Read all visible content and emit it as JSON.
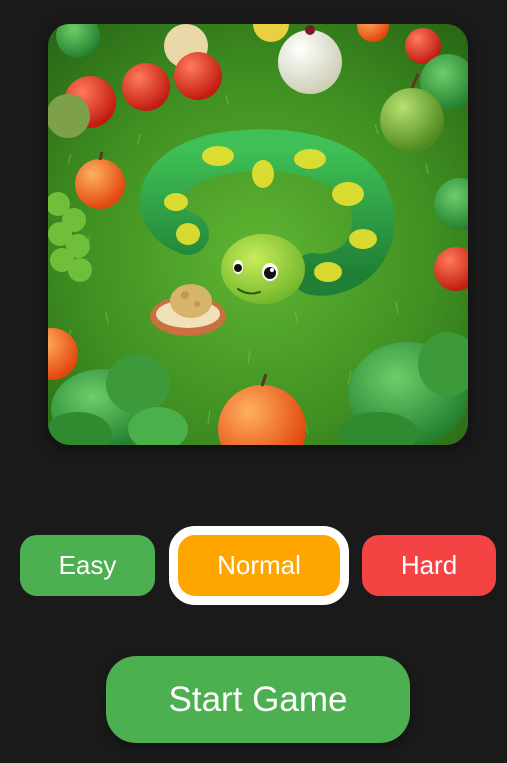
{
  "hero": {
    "image_subject": "cartoon-snake-in-grass-with-fruit"
  },
  "difficulty": {
    "options": [
      {
        "label": "Easy",
        "color": "#4caf50"
      },
      {
        "label": "Normal",
        "color": "#ffa500"
      },
      {
        "label": "Hard",
        "color": "#f44343"
      }
    ],
    "selected": "Normal",
    "selected_outline_color": "#ffffff"
  },
  "start_button": {
    "label": "Start Game",
    "color": "#4caf50"
  },
  "colors": {
    "background": "#1b1a1b",
    "grass": "#3f8f22",
    "snake_body": "#2e9a40",
    "snake_spots": "#e8e030"
  }
}
